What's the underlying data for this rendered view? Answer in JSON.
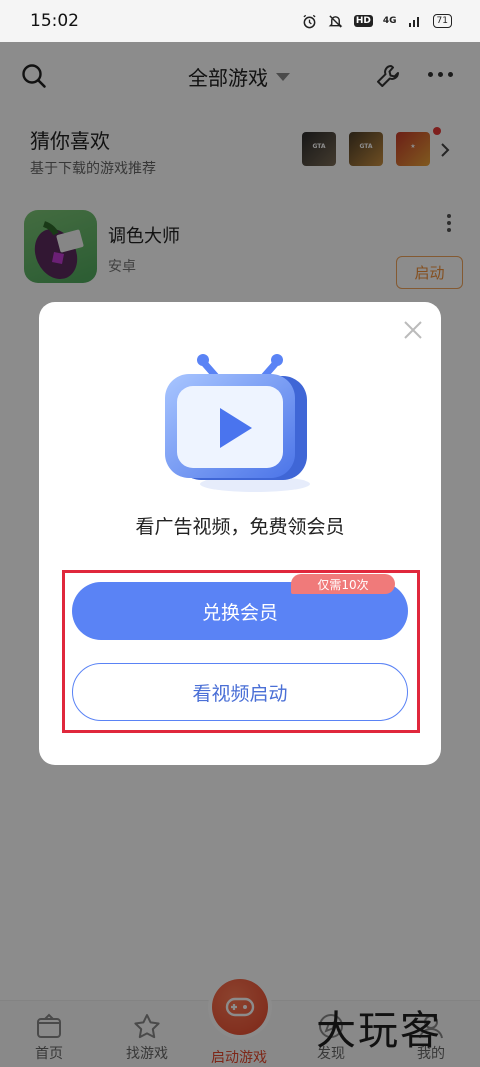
{
  "status_bar": {
    "time": "15:02",
    "network": "4G",
    "hd": "HD",
    "battery": "71"
  },
  "header": {
    "title": "全部游戏",
    "icons": [
      "search-icon",
      "wrench-icon",
      "more-icon"
    ]
  },
  "recommend": {
    "title": "猜你喜欢",
    "subtitle": "基于下载的游戏推荐"
  },
  "game": {
    "name": "调色大师",
    "platform": "安卓",
    "launch_label": "启动"
  },
  "dialog": {
    "message": "看广告视频，免费领会员",
    "primary_label": "兑换会员",
    "badge": "仅需10次",
    "secondary_label": "看视频启动"
  },
  "bottom_nav": {
    "items": [
      {
        "label": "首页",
        "icon": "home-icon"
      },
      {
        "label": "找游戏",
        "icon": "star-icon"
      },
      {
        "label": "启动游戏",
        "icon": "gamepad-icon"
      },
      {
        "label": "发现",
        "icon": "compass-icon"
      },
      {
        "label": "我的",
        "icon": "user-icon"
      }
    ]
  },
  "watermark": "大玩客",
  "colors": {
    "accent_blue": "#5a83f5",
    "accent_orange": "#f0913a",
    "badge_red": "#f07a7a",
    "highlight_red": "#e0283c"
  }
}
